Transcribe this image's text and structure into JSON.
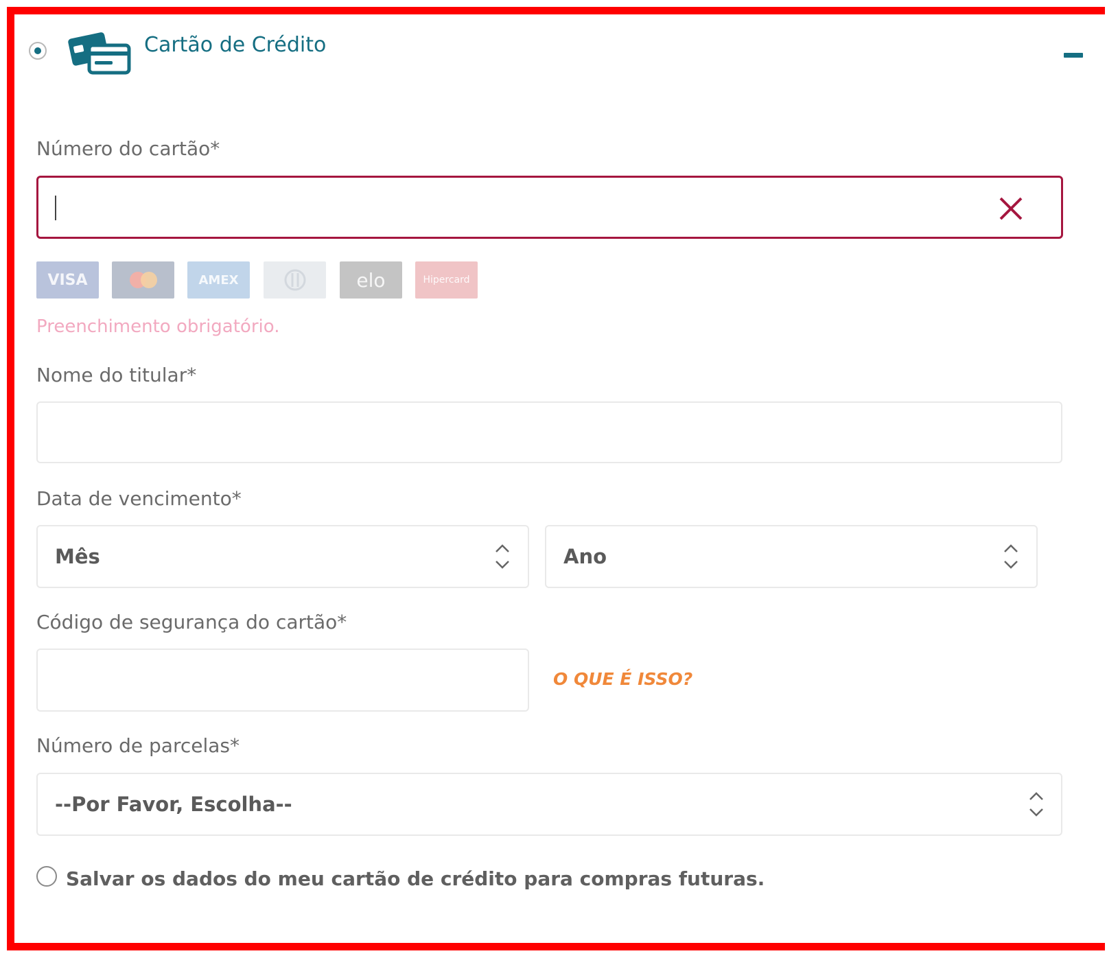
{
  "header": {
    "title": "Cartão de Crédito",
    "selected": true,
    "icon": "credit-cards-icon",
    "collapse_icon": "minus-icon"
  },
  "card_number": {
    "label": "Número do cartão*",
    "value": "",
    "state": "error",
    "clear_icon": "close-icon"
  },
  "card_brands": [
    "VISA",
    "Mastercard",
    "AMEX",
    "Diners",
    "elo",
    "Hipercard"
  ],
  "card_number_error": "Preenchimento obrigatório.",
  "holder_name": {
    "label": "Nome do titular*",
    "value": ""
  },
  "expiry": {
    "label": "Data de vencimento*",
    "month_selected": "Mês",
    "year_selected": "Ano",
    "select_icon": "up-down-chevron-icon"
  },
  "security_code": {
    "label": "Código de segurança do cartão*",
    "value": "",
    "help_link": "O QUE É ISSO?"
  },
  "installments": {
    "label": "Número de parcelas*",
    "selected": "--Por Favor, Escolha--"
  },
  "save_card": {
    "label": "Salvar os dados do meu cartão de crédito para compras futuras.",
    "checked": false
  },
  "colors": {
    "brand": "#156e82",
    "error_border": "#a5163f",
    "error_text": "#f2a9c0",
    "link": "#f0883a",
    "frame": "#ff0000"
  }
}
